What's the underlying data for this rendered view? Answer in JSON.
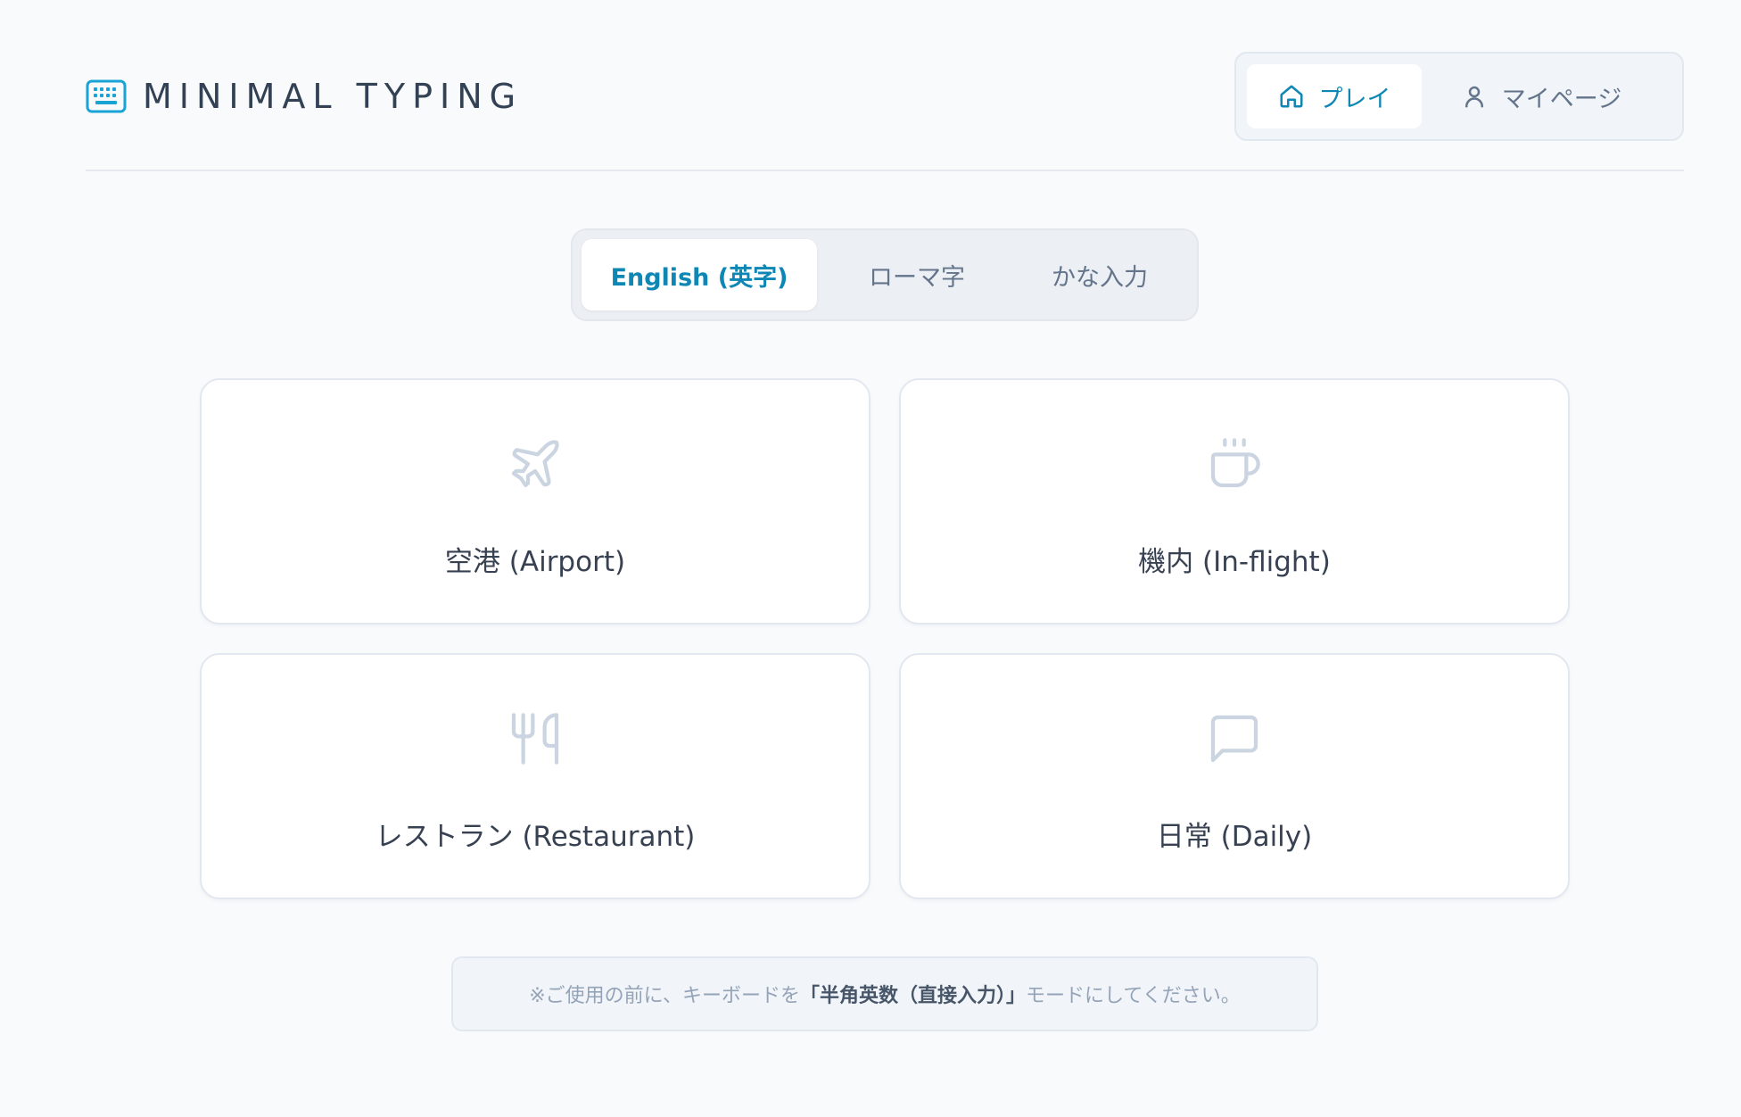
{
  "header": {
    "logo_text": "MINIMAL TYPING",
    "logo_icon": "keyboard-icon",
    "nav": [
      {
        "label": "プレイ",
        "icon": "home-icon",
        "active": true
      },
      {
        "label": "マイページ",
        "icon": "user-icon",
        "active": false
      }
    ]
  },
  "mode_tabs": [
    {
      "label": "English (英字)",
      "active": true
    },
    {
      "label": "ローマ字",
      "active": false
    },
    {
      "label": "かな入力",
      "active": false
    }
  ],
  "categories": [
    {
      "label": "空港 (Airport)",
      "icon": "plane-icon"
    },
    {
      "label": "機内 (In-flight)",
      "icon": "coffee-cup-icon"
    },
    {
      "label": "レストラン (Restaurant)",
      "icon": "utensils-icon"
    },
    {
      "label": "日常 (Daily)",
      "icon": "chat-bubble-icon"
    }
  ],
  "notice": {
    "prefix": "※ご使用の前に、キーボードを",
    "emphasis": "「半角英数（直接入力）」",
    "suffix": "モードにしてください。"
  },
  "colors": {
    "accent": "#0e87b5",
    "background": "#f8fafc",
    "icon_muted": "#cbd5e1"
  }
}
